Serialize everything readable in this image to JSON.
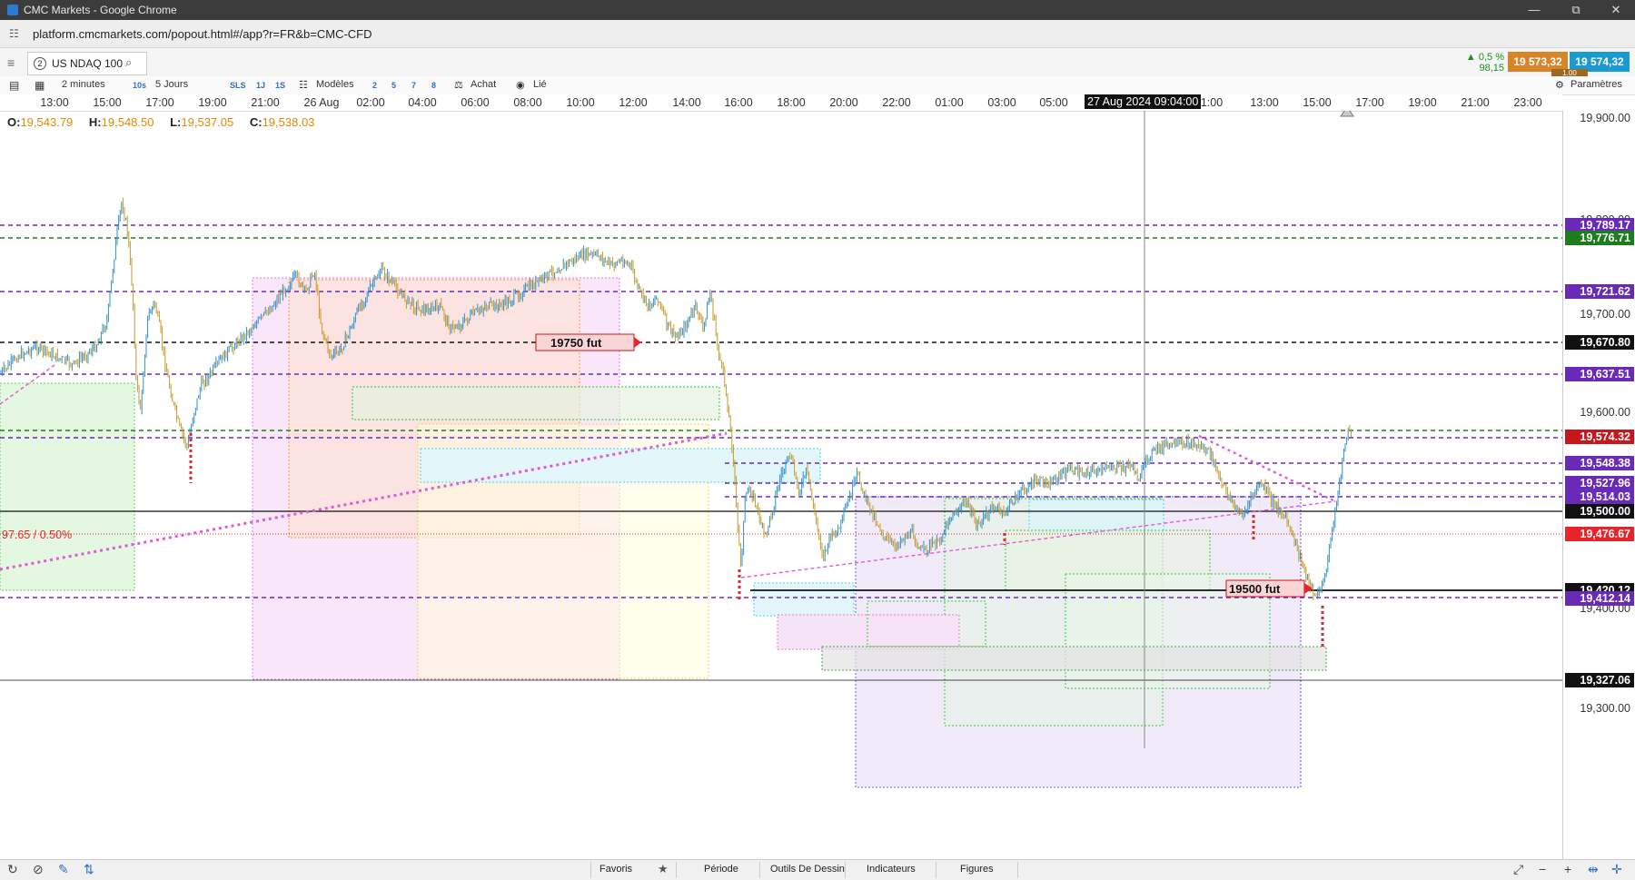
{
  "window": {
    "title": "CMC Markets - Google Chrome",
    "minimize": "—",
    "restore": "⧉",
    "close": "✕"
  },
  "browser": {
    "url": "platform.cmcmarkets.com/popout.html#/app?r=FR&b=CMC-CFD"
  },
  "instrument": {
    "tab_number": "2",
    "name": "US NDAQ 100",
    "change_pct": "▲ 0,5 %",
    "change_pts": "98,15",
    "sell_price": "19 573,32",
    "buy_price": "19 574,32",
    "spread": "1.00"
  },
  "toolbar": {
    "interval": "2 minutes",
    "10s": "10s",
    "range": "5 Jours",
    "sls": "SLS",
    "1j": "1J",
    "1s": "1S",
    "templates": "Modèles",
    "n2": "2",
    "n5": "5",
    "n7": "7",
    "n8": "8",
    "buy": "Achat",
    "linked": "Lié",
    "settings": "Paramètres"
  },
  "time_axis": {
    "labels": [
      "13:00",
      "15:00",
      "17:00",
      "19:00",
      "21:00",
      "26 Aug",
      "02:00",
      "04:00",
      "06:00",
      "08:00",
      "10:00",
      "12:00",
      "14:00",
      "16:00",
      "18:00",
      "20:00",
      "22:00",
      "01:00",
      "03:00",
      "05:00",
      "1:00",
      "13:00",
      "15:00",
      "17:00",
      "19:00",
      "21:00",
      "23:00"
    ],
    "crosshair": "27 Aug 2024 09:04:00"
  },
  "ohlc": {
    "o_label": "O:",
    "o": "19,543.79",
    "h_label": "H:",
    "h": "19,548.50",
    "l_label": "L:",
    "l": "19,537.05",
    "c_label": "C:",
    "c": "19,538.03"
  },
  "price_axis": {
    "ticks": [
      "19,900.00",
      "19,800.00",
      "19,700.00",
      "19,600.00",
      "19,400.00",
      "19,300.00"
    ],
    "tags": [
      {
        "text": "19,789.17",
        "color": "#6a2ab8"
      },
      {
        "text": "19,776.71",
        "color": "#1d7d1d"
      },
      {
        "text": "19,721.62",
        "color": "#6a2ab8"
      },
      {
        "text": "19,670.80",
        "color": "#111111"
      },
      {
        "text": "19,637.51",
        "color": "#6a2ab8"
      },
      {
        "text": "19,574.32",
        "color": "#c8161d"
      },
      {
        "text": "19,548.38",
        "color": "#6a2ab8"
      },
      {
        "text": "19,527.96",
        "color": "#6a2ab8"
      },
      {
        "text": "19,514.03",
        "color": "#6a2ab8"
      },
      {
        "text": "19,500.00",
        "color": "#111111"
      },
      {
        "text": "19,476.67",
        "color": "#e8232a"
      },
      {
        "text": "19,420.12",
        "color": "#111111"
      },
      {
        "text": "19,412.14",
        "color": "#6a2ab8"
      },
      {
        "text": "19,327.06",
        "color": "#111111"
      }
    ]
  },
  "annotations": {
    "label_top": "19750   fut",
    "label_bottom": "19500 fut",
    "pct_line": "97.65 / 0.50%"
  },
  "bottom": {
    "favorites": "Favoris",
    "star": "★",
    "period": "Période",
    "drawing": "Outils De Dessin",
    "indicators": "Indicateurs",
    "figures": "Figures"
  },
  "colors": {
    "purple_level": "#6a2ab8",
    "green_level": "#1d7d1d",
    "magenta_trend": "#e05ad8",
    "candle_up": "#2f8fcc",
    "candle_dn": "#c49a2a"
  }
}
